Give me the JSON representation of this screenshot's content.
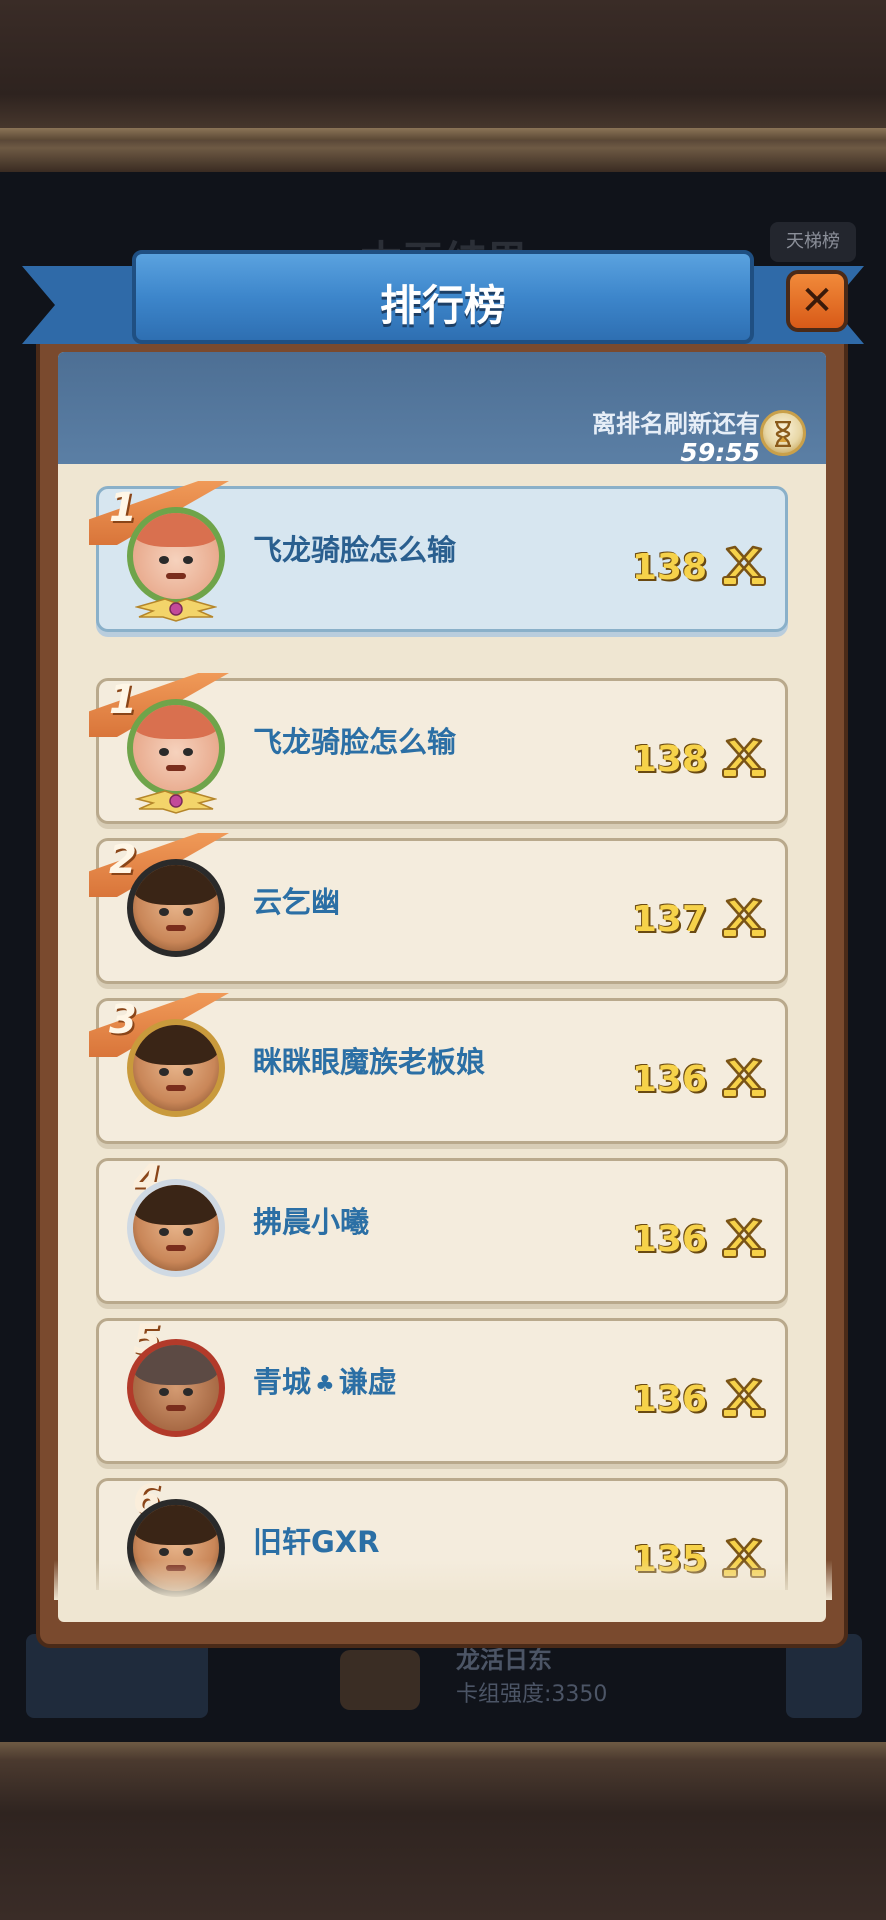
{
  "background": {
    "title": "本王结果",
    "ladder_button": "天梯榜",
    "deck_name": "龙活日东",
    "deck_power": "卡组强度:3350"
  },
  "header": {
    "title": "排行榜",
    "close_label": "✕"
  },
  "refresh": {
    "label": "离排名刷新还有",
    "time": "59:55"
  },
  "self_entry": {
    "rank": "1",
    "name": "飞龙骑脸怎么输",
    "score": "138",
    "avatar": "girl"
  },
  "entries": [
    {
      "rank": "1",
      "name": "飞龙骑脸怎么输",
      "score": "138",
      "avatar": "girl"
    },
    {
      "rank": "2",
      "name": "云乞幽",
      "score": "137",
      "avatar": "dark"
    },
    {
      "rank": "3",
      "name": "眯眯眼魔族老板娘",
      "score": "136",
      "avatar": "gold"
    },
    {
      "rank": "4",
      "name": "拂晨小曦",
      "score": "136",
      "avatar": "silver"
    },
    {
      "rank": "5",
      "name_part1": "青城",
      "name_part2": "谦虚",
      "score": "136",
      "avatar": "red"
    },
    {
      "rank": "6",
      "name": "旧轩GXR",
      "score": "135",
      "avatar": "dark"
    }
  ],
  "colors": {
    "accent_blue": "#3d86cb",
    "ribbon_orange": "#d9753a",
    "score_gold": "#f6d24a",
    "name_blue": "#2b6fa5"
  },
  "icons": {
    "close": "close-icon",
    "refresh": "hourglass-icon",
    "score": "crossed-swords-icon",
    "clover": "clover-icon"
  }
}
